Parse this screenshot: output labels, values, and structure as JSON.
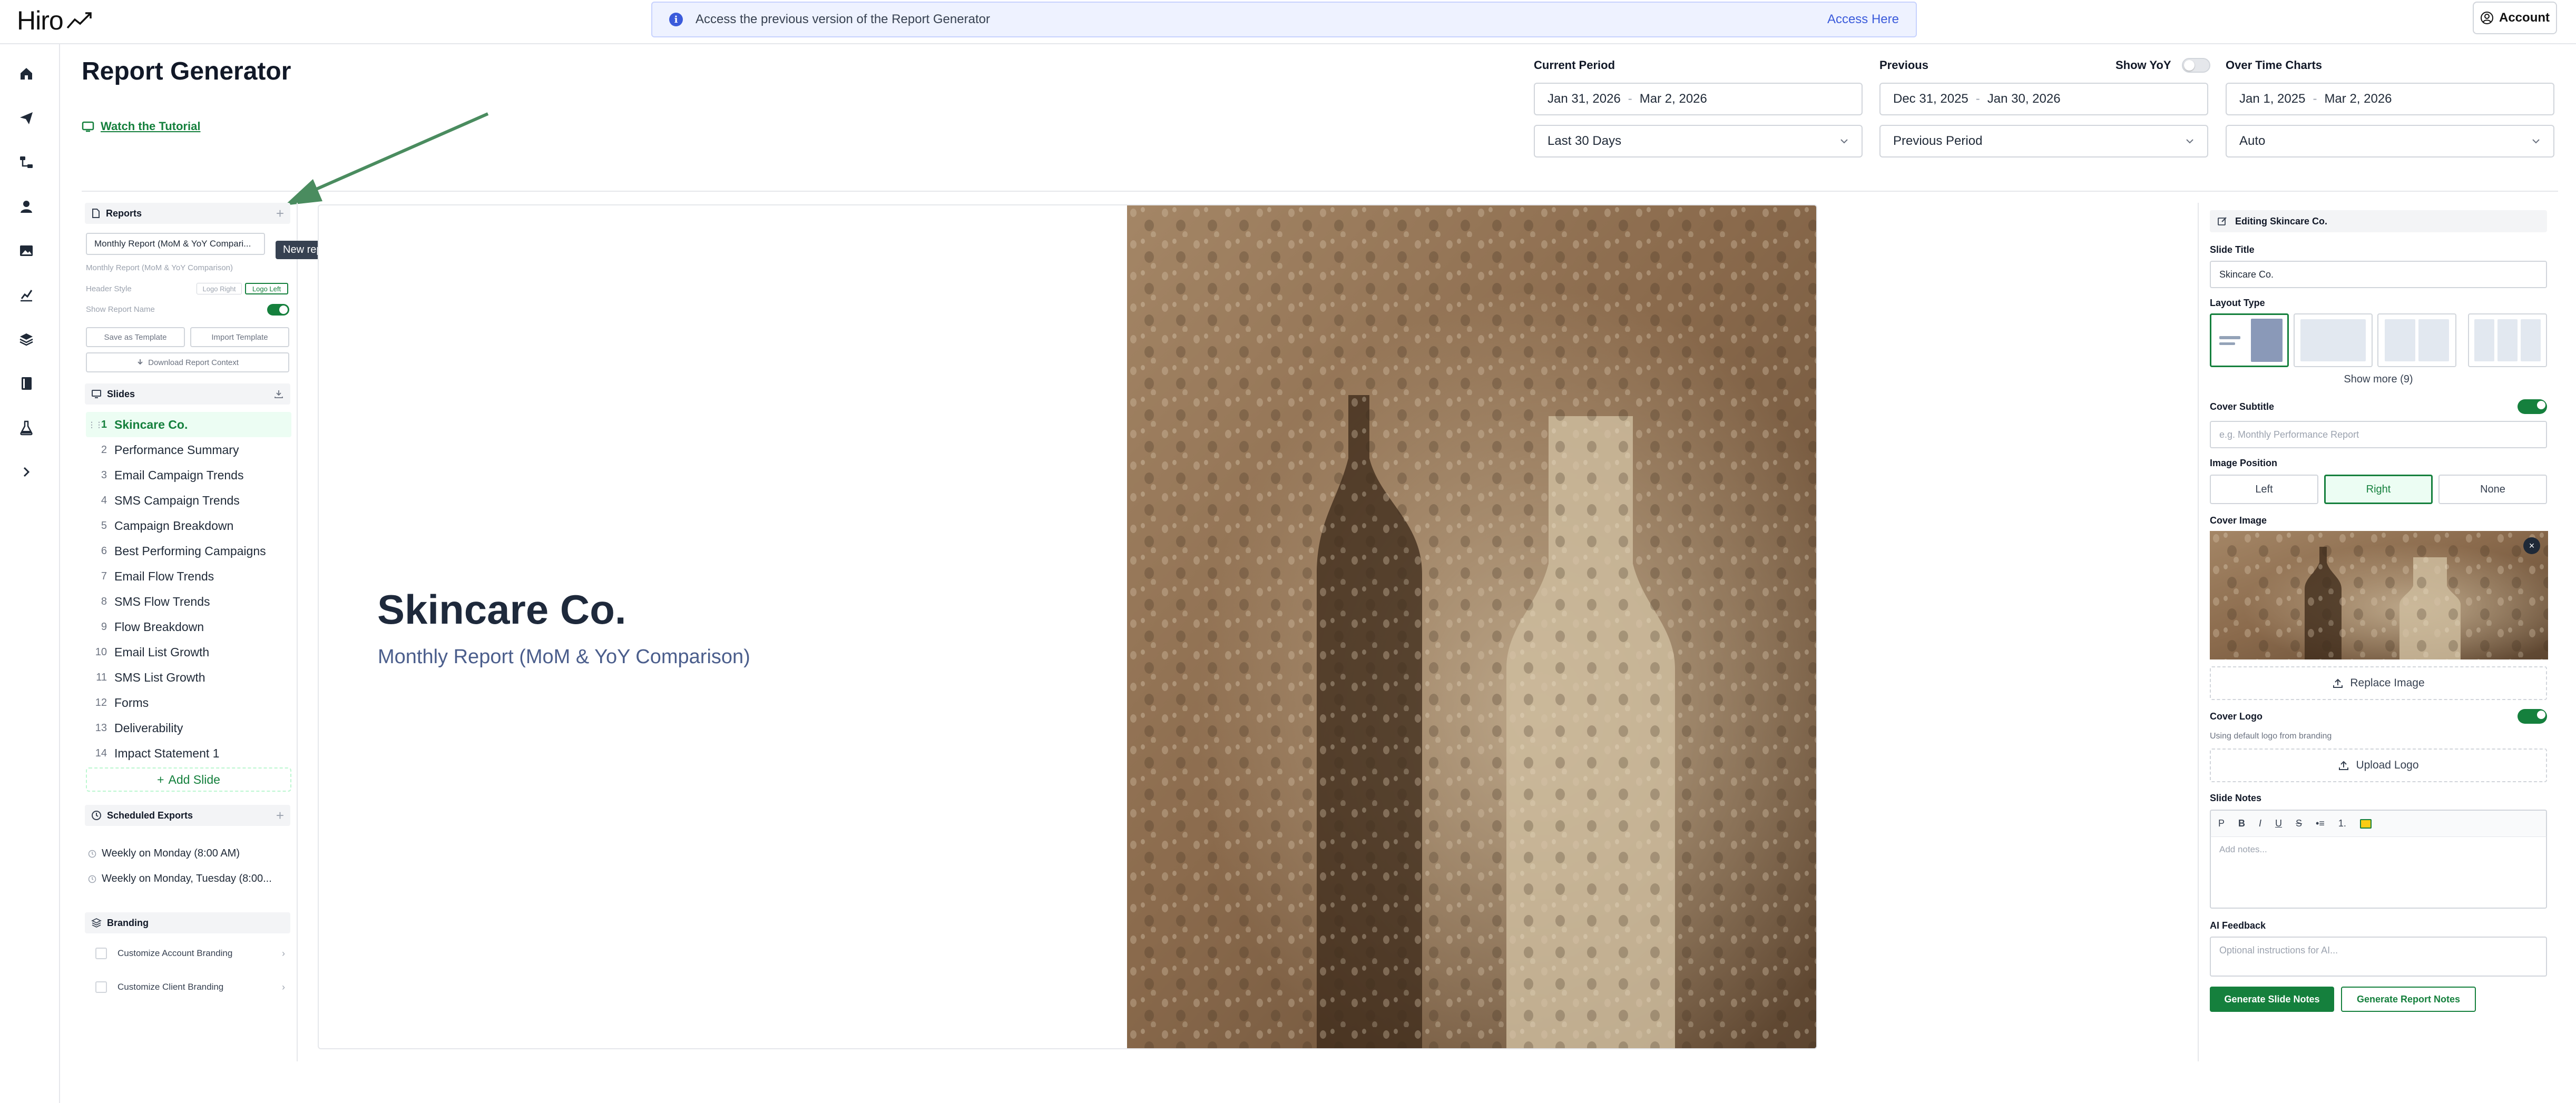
{
  "app": {
    "logo_text": "Hiro",
    "banner_text": "Access the previous version of the Report Generator",
    "banner_link": "Access Here",
    "account_label": "Account"
  },
  "nav_icons": [
    "home-icon",
    "send-icon",
    "flow-icon",
    "user-icon",
    "image-icon",
    "chart-icon",
    "layers-icon",
    "book-icon",
    "flask-icon",
    "expand-icon"
  ],
  "header": {
    "title": "Report Generator",
    "tutorial_label": "Watch the Tutorial",
    "current_period": {
      "label": "Current Period",
      "start": "Jan 31, 2026",
      "end": "Mar 2, 2026",
      "preset": "Last 30 Days"
    },
    "previous": {
      "label": "Previous",
      "start": "Dec 31, 2025",
      "end": "Jan 30, 2026",
      "preset": "Previous Period",
      "yoy_label": "Show YoY"
    },
    "over_time": {
      "label": "Over Time Charts",
      "start": "Jan 1, 2025",
      "end": "Mar 2, 2026",
      "preset": "Auto"
    },
    "date_separator": "-"
  },
  "reports": {
    "heading": "Reports",
    "selected": "Monthly Report (MoM & YoY Compari...",
    "name_preview": "Monthly Report (MoM & YoY Comparison)",
    "tooltip": "New report",
    "header_style_label": "Header Style",
    "header_style_options": [
      "Logo Right",
      "Logo Left"
    ],
    "show_name_label": "Show Report Name",
    "save_template": "Save as Template",
    "import_template": "Import Template",
    "download_context": "Download Report Context"
  },
  "slides": {
    "heading": "Slides",
    "items": [
      {
        "num": "1",
        "label": "Skincare Co."
      },
      {
        "num": "2",
        "label": "Performance Summary"
      },
      {
        "num": "3",
        "label": "Email Campaign Trends"
      },
      {
        "num": "4",
        "label": "SMS Campaign Trends"
      },
      {
        "num": "5",
        "label": "Campaign Breakdown"
      },
      {
        "num": "6",
        "label": "Best Performing Campaigns"
      },
      {
        "num": "7",
        "label": "Email Flow Trends"
      },
      {
        "num": "8",
        "label": "SMS Flow Trends"
      },
      {
        "num": "9",
        "label": "Flow Breakdown"
      },
      {
        "num": "10",
        "label": "Email List Growth"
      },
      {
        "num": "11",
        "label": "SMS List Growth"
      },
      {
        "num": "12",
        "label": "Forms"
      },
      {
        "num": "13",
        "label": "Deliverability"
      },
      {
        "num": "14",
        "label": "Impact Statement 1"
      }
    ],
    "add_label": "Add Slide"
  },
  "scheduled": {
    "heading": "Scheduled Exports",
    "items": [
      "Weekly on Monday (8:00 AM)",
      "Weekly on Monday, Tuesday (8:00..."
    ]
  },
  "branding": {
    "heading": "Branding",
    "items": [
      "Customize Account Branding",
      "Customize Client Branding"
    ]
  },
  "slide_preview": {
    "title": "Skincare Co.",
    "subtitle": "Monthly Report (MoM & YoY Comparison)"
  },
  "editor": {
    "heading": "Editing Skincare Co.",
    "slide_title_label": "Slide Title",
    "slide_title_value": "Skincare Co.",
    "layout_type_label": "Layout Type",
    "show_more": "Show more (9)",
    "cover_subtitle_label": "Cover Subtitle",
    "cover_subtitle_placeholder": "e.g. Monthly Performance Report",
    "image_position_label": "Image Position",
    "image_positions": [
      "Left",
      "Right",
      "None"
    ],
    "cover_image_label": "Cover Image",
    "replace_image": "Replace Image",
    "cover_logo_label": "Cover Logo",
    "cover_logo_note": "Using default logo from branding",
    "upload_logo": "Upload Logo",
    "slide_notes_label": "Slide Notes",
    "toolbar": [
      "P",
      "B",
      "I",
      "U",
      "S",
      "•≡",
      "1."
    ],
    "notes_placeholder": "Add notes...",
    "ai_feedback_label": "AI Feedback",
    "ai_feedback_placeholder": "Optional instructions for AI...",
    "generate_slide_notes": "Generate Slide Notes",
    "generate_report_notes": "Generate Report Notes"
  },
  "colors": {
    "accent": "#15803d",
    "banner_bg": "#eef2ff",
    "title": "#1e293b",
    "subtitle": "#4b5e8c"
  }
}
